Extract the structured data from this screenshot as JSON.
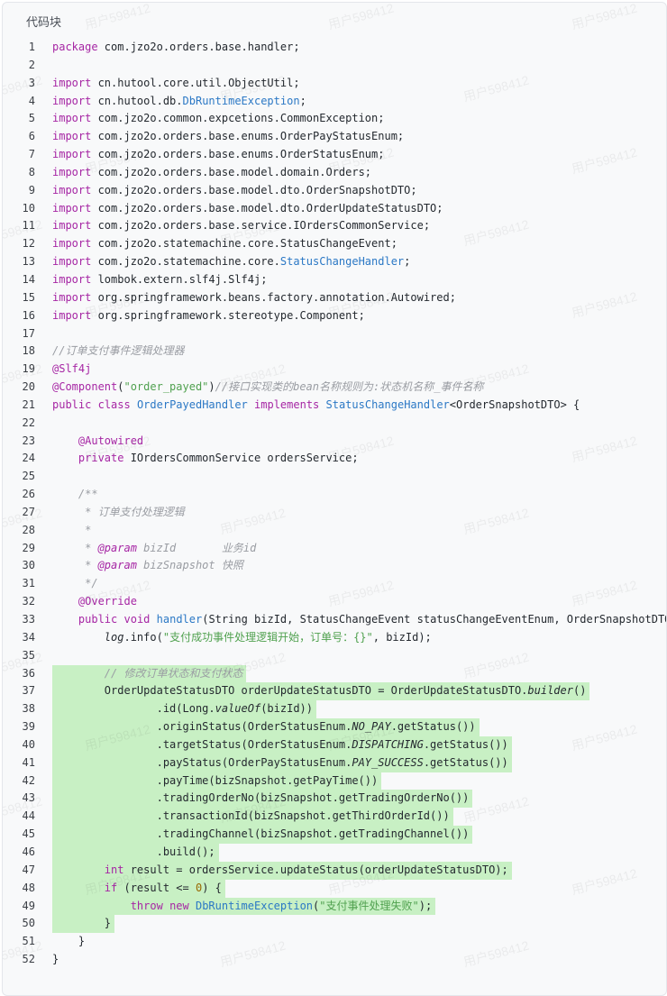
{
  "panel": {
    "title": "代码块"
  },
  "watermark": "用户598412",
  "colors": {
    "highlight": "#c8f0c4",
    "keyword": "#a626a4",
    "type": "#2b78c5",
    "string": "#50a14f",
    "comment": "#9a9da3"
  },
  "code": {
    "highlighted_lines": [
      36,
      37,
      38,
      39,
      40,
      41,
      42,
      43,
      44,
      45,
      46,
      47,
      48,
      49,
      50
    ],
    "lines": [
      "package com.jzo2o.orders.base.handler;",
      "",
      "import cn.hutool.core.util.ObjectUtil;",
      "import cn.hutool.db.DbRuntimeException;",
      "import com.jzo2o.common.expcetions.CommonException;",
      "import com.jzo2o.orders.base.enums.OrderPayStatusEnum;",
      "import com.jzo2o.orders.base.enums.OrderStatusEnum;",
      "import com.jzo2o.orders.base.model.domain.Orders;",
      "import com.jzo2o.orders.base.model.dto.OrderSnapshotDTO;",
      "import com.jzo2o.orders.base.model.dto.OrderUpdateStatusDTO;",
      "import com.jzo2o.orders.base.service.IOrdersCommonService;",
      "import com.jzo2o.statemachine.core.StatusChangeEvent;",
      "import com.jzo2o.statemachine.core.StatusChangeHandler;",
      "import lombok.extern.slf4j.Slf4j;",
      "import org.springframework.beans.factory.annotation.Autowired;",
      "import org.springframework.stereotype.Component;",
      "",
      "//订单支付事件逻辑处理器",
      "@Slf4j",
      "@Component(\"order_payed\")//接口实现类的bean名称规则为:状态机名称_事件名称",
      "public class OrderPayedHandler implements StatusChangeHandler<OrderSnapshotDTO> {",
      "",
      "    @Autowired",
      "    private IOrdersCommonService ordersService;",
      "",
      "    /**",
      "     * 订单支付处理逻辑",
      "     *",
      "     * @param bizId       业务id",
      "     * @param bizSnapshot 快照",
      "     */",
      "    @Override",
      "    public void handler(String bizId, StatusChangeEvent statusChangeEventEnum, OrderSnapshotDTO bizSnapshot) {",
      "        log.info(\"支付成功事件处理逻辑开始，订单号：{}\", bizId);",
      "",
      "        // 修改订单状态和支付状态",
      "        OrderUpdateStatusDTO orderUpdateStatusDTO = OrderUpdateStatusDTO.builder()",
      "                .id(Long.valueOf(bizId))",
      "                .originStatus(OrderStatusEnum.NO_PAY.getStatus())",
      "                .targetStatus(OrderStatusEnum.DISPATCHING.getStatus())",
      "                .payStatus(OrderPayStatusEnum.PAY_SUCCESS.getStatus())",
      "                .payTime(bizSnapshot.getPayTime())",
      "                .tradingOrderNo(bizSnapshot.getTradingOrderNo())",
      "                .transactionId(bizSnapshot.getThirdOrderId())",
      "                .tradingChannel(bizSnapshot.getTradingChannel())",
      "                .build();",
      "        int result = ordersService.updateStatus(orderUpdateStatusDTO);",
      "        if (result <= 0) {",
      "            throw new DbRuntimeException(\"支付事件处理失败\");",
      "        }",
      "    }",
      "}"
    ]
  }
}
